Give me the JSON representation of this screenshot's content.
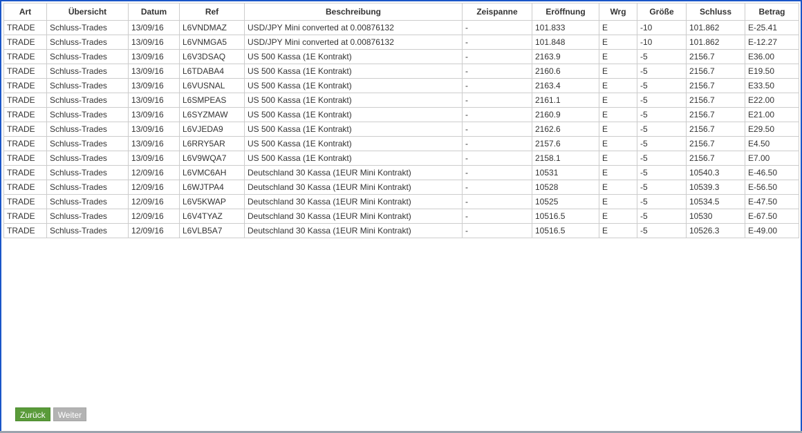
{
  "table": {
    "headers": [
      "Art",
      "Übersicht",
      "Datum",
      "Ref",
      "Beschreibung",
      "Zeispanne",
      "Eröffnung",
      "Wrg",
      "Größe",
      "Schluss",
      "Betrag"
    ],
    "rows": [
      [
        "TRADE",
        "Schluss-Trades",
        "13/09/16",
        "L6VNDMAZ",
        "USD/JPY Mini converted at 0.00876132",
        "-",
        "101.833",
        "E",
        "-10",
        "101.862",
        "E-25.41"
      ],
      [
        "TRADE",
        "Schluss-Trades",
        "13/09/16",
        "L6VNMGA5",
        "USD/JPY Mini converted at 0.00876132",
        "-",
        "101.848",
        "E",
        "-10",
        "101.862",
        "E-12.27"
      ],
      [
        "TRADE",
        "Schluss-Trades",
        "13/09/16",
        "L6V3DSAQ",
        "US 500 Kassa (1E Kontrakt)",
        "-",
        "2163.9",
        "E",
        "-5",
        "2156.7",
        "E36.00"
      ],
      [
        "TRADE",
        "Schluss-Trades",
        "13/09/16",
        "L6TDABA4",
        "US 500 Kassa (1E Kontrakt)",
        "-",
        "2160.6",
        "E",
        "-5",
        "2156.7",
        "E19.50"
      ],
      [
        "TRADE",
        "Schluss-Trades",
        "13/09/16",
        "L6VUSNAL",
        "US 500 Kassa (1E Kontrakt)",
        "-",
        "2163.4",
        "E",
        "-5",
        "2156.7",
        "E33.50"
      ],
      [
        "TRADE",
        "Schluss-Trades",
        "13/09/16",
        "L6SMPEAS",
        "US 500 Kassa (1E Kontrakt)",
        "-",
        "2161.1",
        "E",
        "-5",
        "2156.7",
        "E22.00"
      ],
      [
        "TRADE",
        "Schluss-Trades",
        "13/09/16",
        "L6SYZMAW",
        "US 500 Kassa (1E Kontrakt)",
        "-",
        "2160.9",
        "E",
        "-5",
        "2156.7",
        "E21.00"
      ],
      [
        "TRADE",
        "Schluss-Trades",
        "13/09/16",
        "L6VJEDA9",
        "US 500 Kassa (1E Kontrakt)",
        "-",
        "2162.6",
        "E",
        "-5",
        "2156.7",
        "E29.50"
      ],
      [
        "TRADE",
        "Schluss-Trades",
        "13/09/16",
        "L6RRY5AR",
        "US 500 Kassa (1E Kontrakt)",
        "-",
        "2157.6",
        "E",
        "-5",
        "2156.7",
        "E4.50"
      ],
      [
        "TRADE",
        "Schluss-Trades",
        "13/09/16",
        "L6V9WQA7",
        "US 500 Kassa (1E Kontrakt)",
        "-",
        "2158.1",
        "E",
        "-5",
        "2156.7",
        "E7.00"
      ],
      [
        "TRADE",
        "Schluss-Trades",
        "12/09/16",
        "L6VMC6AH",
        "Deutschland 30 Kassa (1EUR Mini Kontrakt)",
        "-",
        "10531",
        "E",
        "-5",
        "10540.3",
        "E-46.50"
      ],
      [
        "TRADE",
        "Schluss-Trades",
        "12/09/16",
        "L6WJTPA4",
        "Deutschland 30 Kassa (1EUR Mini Kontrakt)",
        "-",
        "10528",
        "E",
        "-5",
        "10539.3",
        "E-56.50"
      ],
      [
        "TRADE",
        "Schluss-Trades",
        "12/09/16",
        "L6V5KWAP",
        "Deutschland 30 Kassa (1EUR Mini Kontrakt)",
        "-",
        "10525",
        "E",
        "-5",
        "10534.5",
        "E-47.50"
      ],
      [
        "TRADE",
        "Schluss-Trades",
        "12/09/16",
        "L6V4TYAZ",
        "Deutschland 30 Kassa (1EUR Mini Kontrakt)",
        "-",
        "10516.5",
        "E",
        "-5",
        "10530",
        "E-67.50"
      ],
      [
        "TRADE",
        "Schluss-Trades",
        "12/09/16",
        "L6VLB5A7",
        "Deutschland 30 Kassa (1EUR Mini Kontrakt)",
        "-",
        "10516.5",
        "E",
        "-5",
        "10526.3",
        "E-49.00"
      ]
    ]
  },
  "pagination": {
    "back_label": "Zurück",
    "next_label": "Weiter"
  },
  "colors": {
    "window_border": "#1a56c8",
    "back_button": "#5a9b3a",
    "next_button_disabled": "#b3b3b3",
    "grid_line": "#cccccc"
  }
}
